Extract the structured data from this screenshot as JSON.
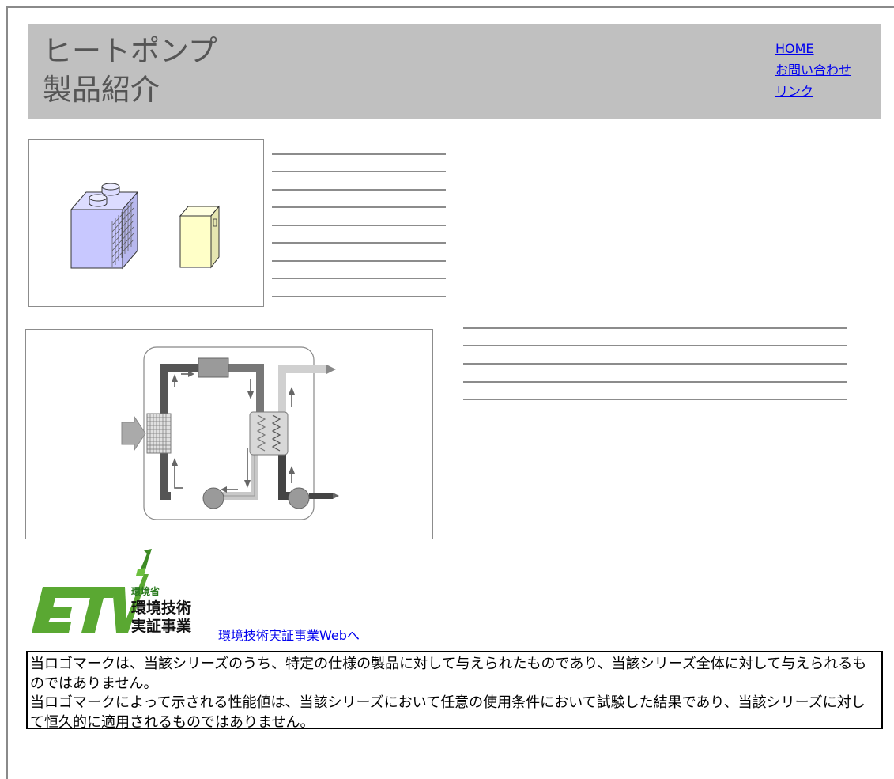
{
  "header": {
    "title_line1": "ヒートポンプ",
    "title_line2": "製品紹介",
    "background_color": "#c0c0c0"
  },
  "nav": {
    "items": [
      {
        "label": "HOME"
      },
      {
        "label": "お問い合わせ"
      },
      {
        "label": "リンク"
      }
    ]
  },
  "etv": {
    "logo_text_line1": "環境省",
    "logo_text_line2": "環境技術",
    "logo_text_line3": "実証事業",
    "link_label": "環境技術実証事業Webへ",
    "logo_color": "#5aa832"
  },
  "notice": {
    "paragraph1": "当ロゴマークは、当該シリーズのうち、特定の仕様の製品に対して与えられたものであり、当該シリーズ全体に対して与えられるものではありません。",
    "paragraph2": "当ロゴマークによって示される性能値は、当該シリーズにおいて任意の使用条件において試験した結果であり、当該シリーズに対して恒久的に適用されるものではありません。"
  }
}
